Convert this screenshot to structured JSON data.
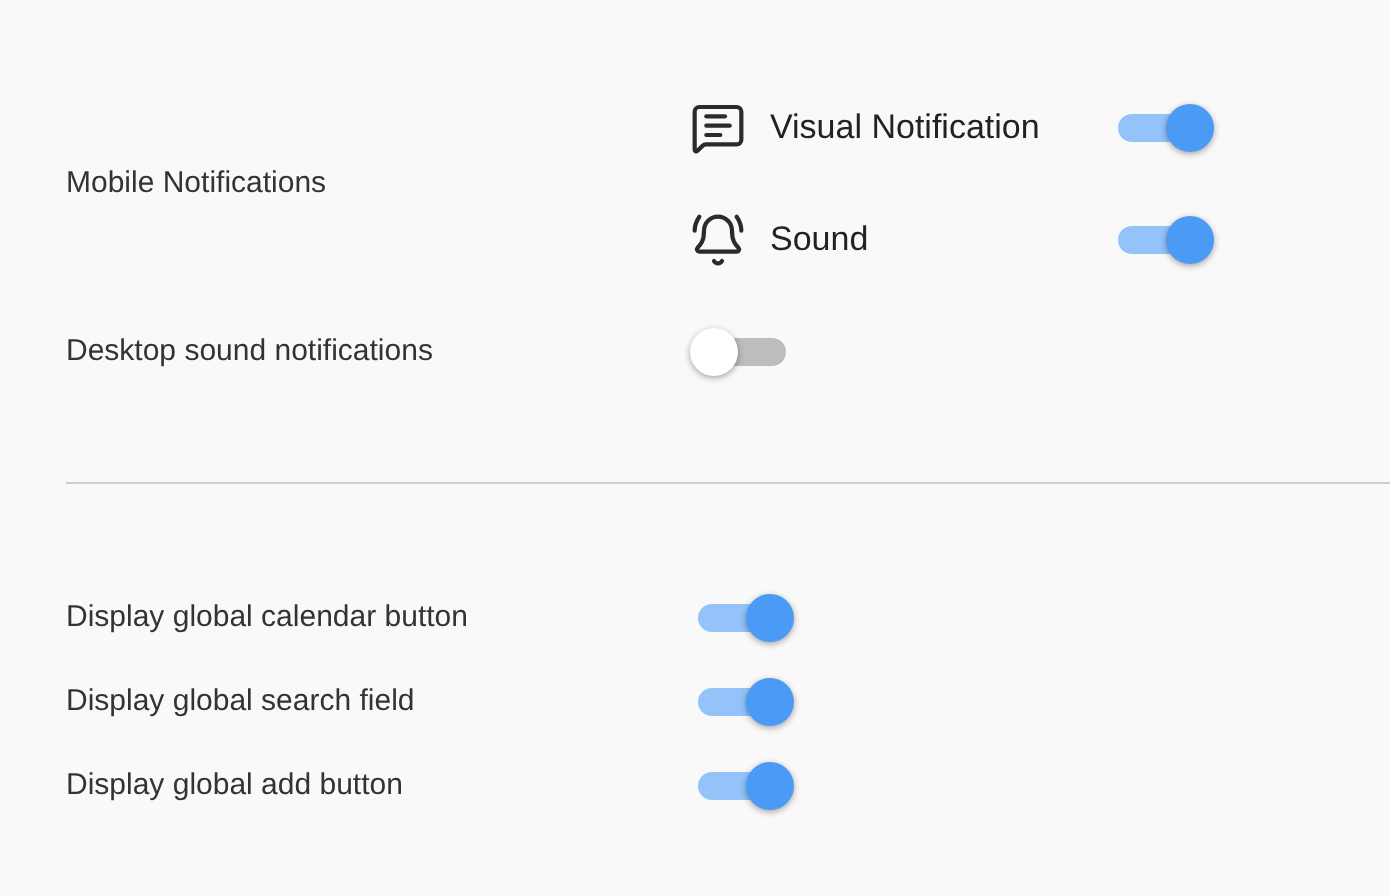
{
  "mobile_notifications": {
    "label": "Mobile Notifications",
    "options": [
      {
        "kind": "message",
        "label": "Visual Notification",
        "on": true
      },
      {
        "kind": "bell",
        "label": "Sound",
        "on": true
      }
    ]
  },
  "desktop_sound": {
    "label": "Desktop sound notifications",
    "on": false
  },
  "global_settings": [
    {
      "label": "Display global calendar button",
      "on": true
    },
    {
      "label": "Display global search field",
      "on": true
    },
    {
      "label": "Display global add button",
      "on": true
    }
  ]
}
